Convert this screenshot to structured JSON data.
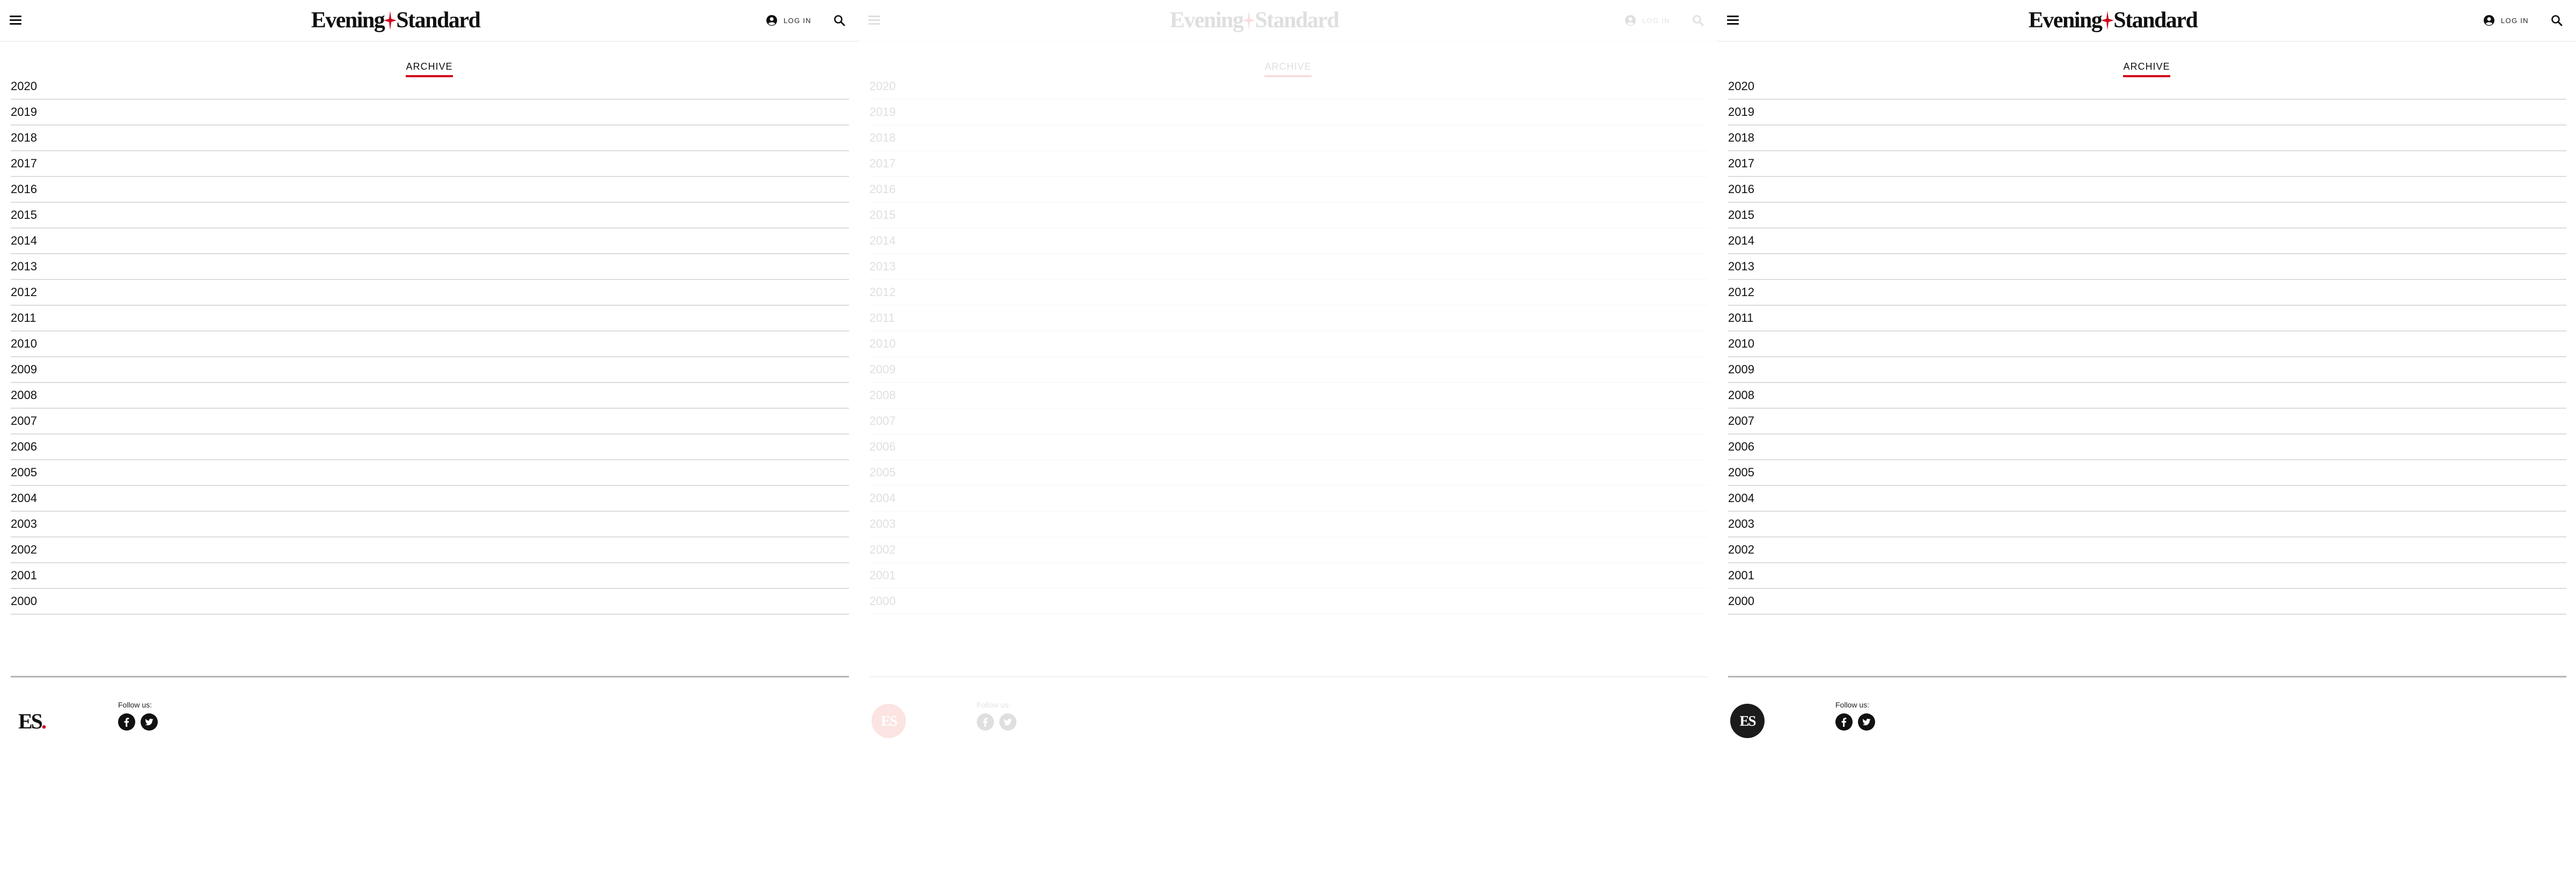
{
  "header": {
    "logo_left": "Evening",
    "logo_right": "Standard",
    "login_label": "LOG IN"
  },
  "archive": {
    "title": "ARCHIVE",
    "years": [
      "2020",
      "2019",
      "2018",
      "2017",
      "2016",
      "2015",
      "2014",
      "2013",
      "2012",
      "2011",
      "2010",
      "2009",
      "2008",
      "2007",
      "2006",
      "2005",
      "2004",
      "2003",
      "2002",
      "2001",
      "2000"
    ]
  },
  "footer": {
    "follow_label": "Follow us:",
    "es_mark": "ES",
    "es_dot": "."
  },
  "icons": {
    "menu": "hamburger-menu-icon",
    "user": "user-circle-icon",
    "search": "search-icon",
    "facebook": "facebook-icon",
    "twitter": "twitter-icon",
    "spark": "es-star-spark-icon"
  },
  "colors": {
    "accent": "#d0021b",
    "badge_red": "#e8352a",
    "badge_dark": "#1b1b1b"
  }
}
